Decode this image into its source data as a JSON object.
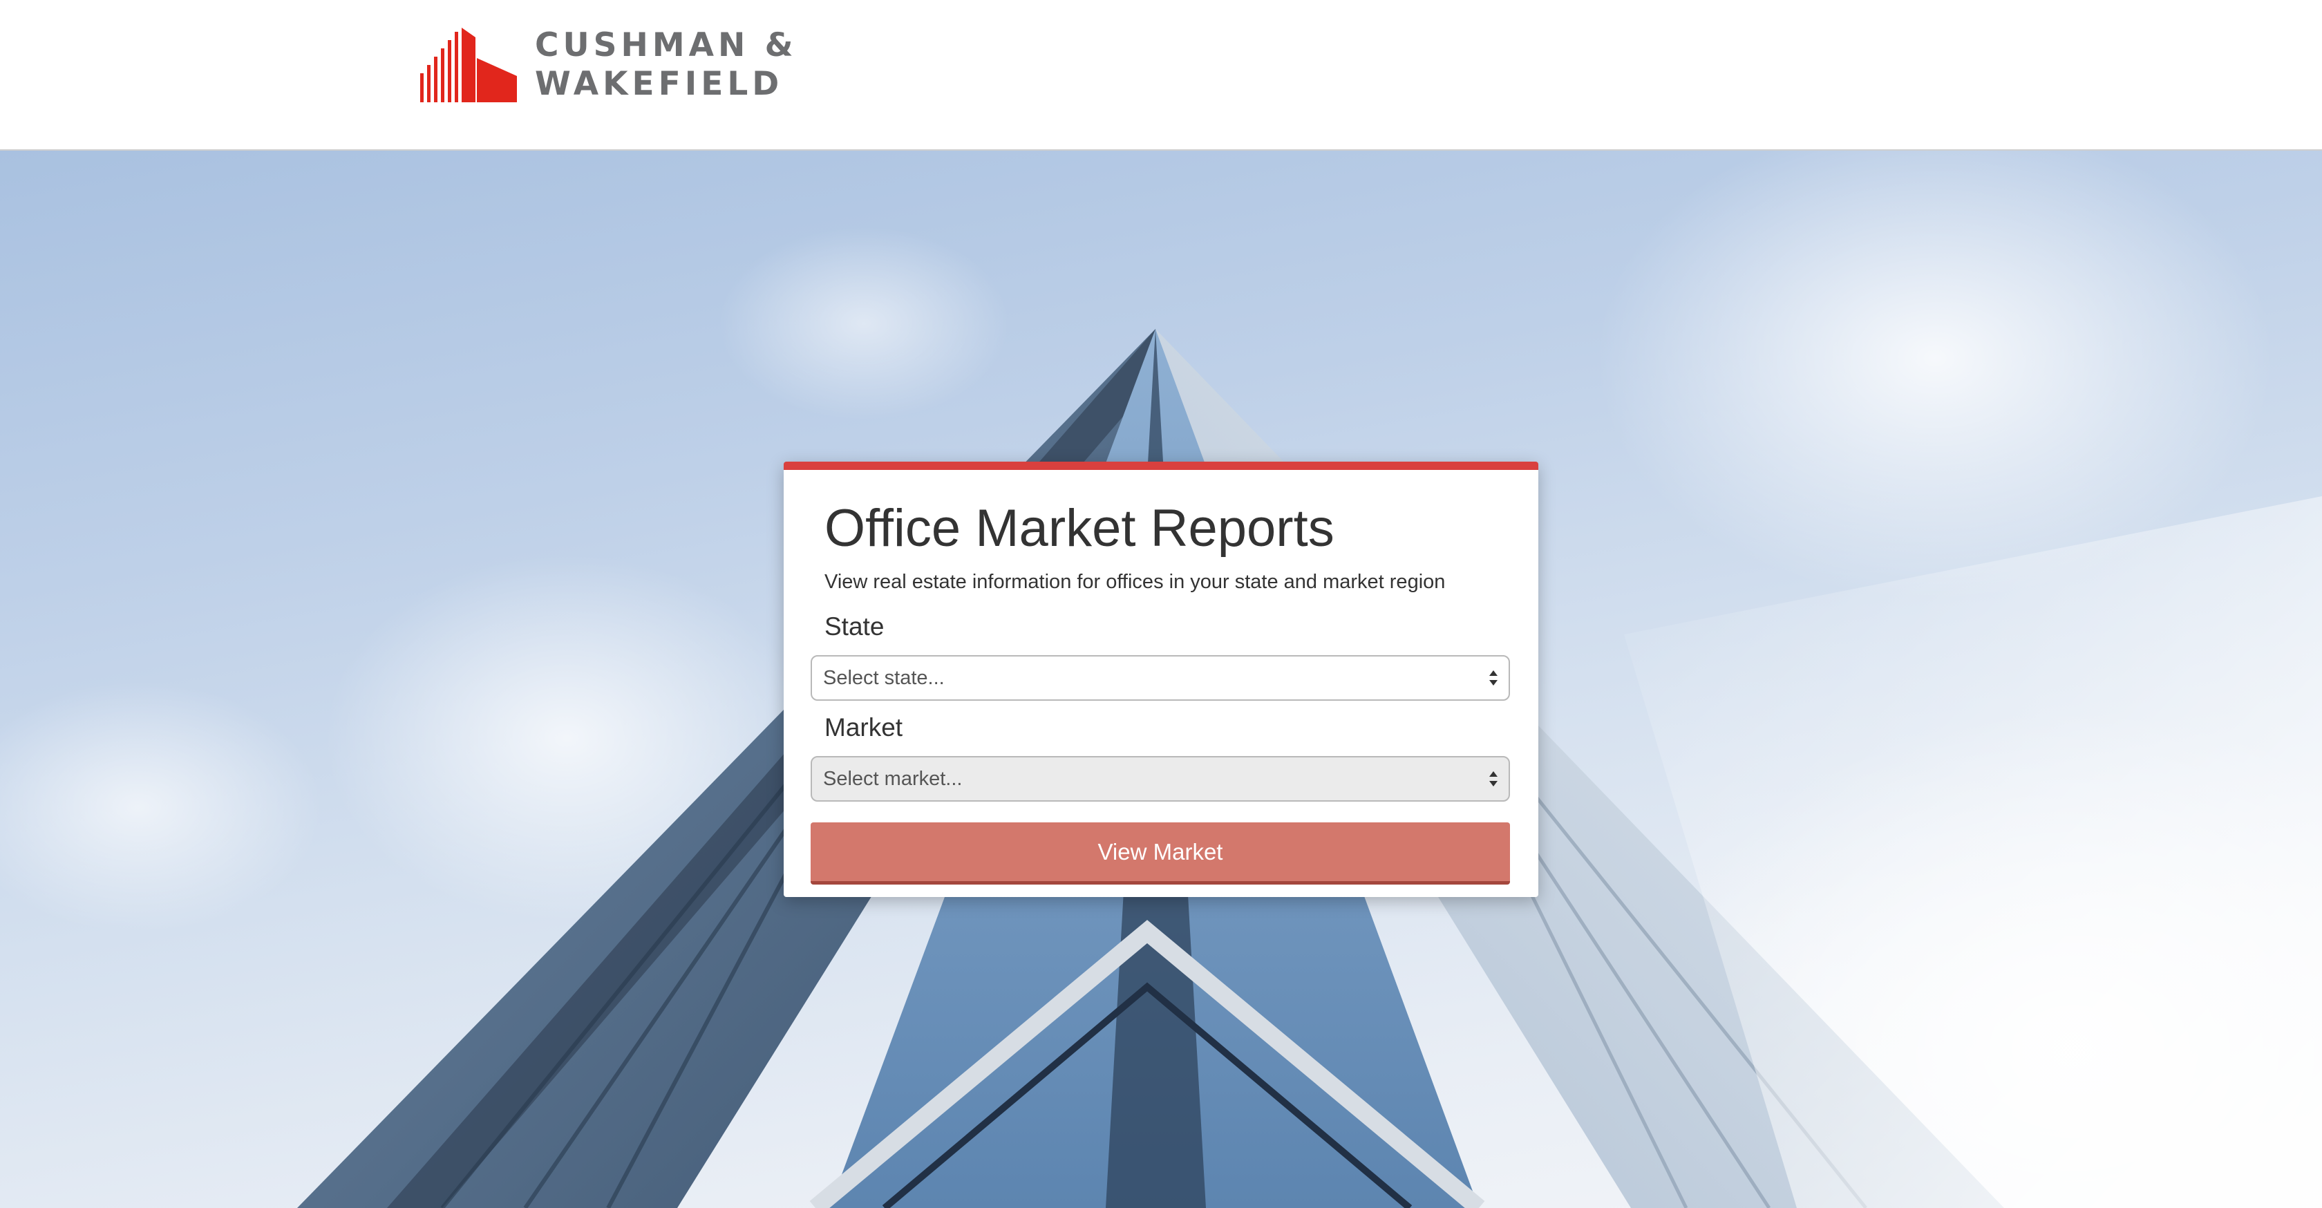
{
  "header": {
    "logo": {
      "line1": "CUSHMAN &",
      "line2": "WAKEFIELD",
      "brand_color": "#e1261c",
      "text_color": "#6d6e70"
    }
  },
  "hero": {
    "background": "sky-with-glass-office-building-photo"
  },
  "card": {
    "accent_color": "#d9403e",
    "title": "Office Market Reports",
    "subtitle": "View real estate information for offices in your state and market region",
    "state": {
      "label": "State",
      "selected": "Select state...",
      "icon": "select-arrows-icon"
    },
    "market": {
      "label": "Market",
      "selected": "Select market...",
      "icon": "select-arrows-icon",
      "disabled": true
    },
    "submit_label": "View Market",
    "button_color": "#d3786c"
  }
}
